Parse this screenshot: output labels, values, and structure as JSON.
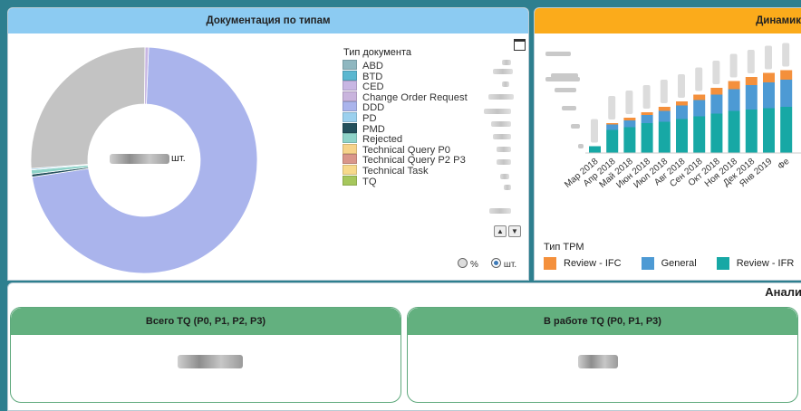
{
  "panels": {
    "documents_by_type": {
      "title": "Документация по типам",
      "center_unit": "шт.",
      "legend_title": "Тип документа",
      "legend": [
        {
          "label": "ABD",
          "color": "#8fb7c0"
        },
        {
          "label": "BTD",
          "color": "#5ab7d0"
        },
        {
          "label": "CED",
          "color": "#c8b6e3"
        },
        {
          "label": "Change Order Request",
          "color": "#c9b4dd"
        },
        {
          "label": "DDD",
          "color": "#aab4ec"
        },
        {
          "label": "PD",
          "color": "#9bd0ee"
        },
        {
          "label": "PMD",
          "color": "#23505c"
        },
        {
          "label": "Rejected",
          "color": "#8ed3c8"
        },
        {
          "label": "Technical Query P0",
          "color": "#f6d38a"
        },
        {
          "label": "Technical Query P2 P3",
          "color": "#d9968a"
        },
        {
          "label": "Technical Task",
          "color": "#f7d98b"
        },
        {
          "label": "TQ",
          "color": "#a6c75c"
        }
      ],
      "toggle": {
        "percent_label": "%",
        "count_label": "шт.",
        "selected": "шт."
      },
      "icons": {
        "maximize": "maximize-icon",
        "scroll_up": "chevron-up-icon",
        "scroll_down": "chevron-down-icon"
      }
    },
    "dynamics": {
      "title_visible": "Динамик",
      "month_labels": [
        "Мар 2018",
        "Апр 2018",
        "Май 2018",
        "Июн 2018",
        "Июл 2018",
        "Авг 2018",
        "Сен 2018",
        "Окт 2018",
        "Ноя 2018",
        "Дек 2018",
        "Янв 2019",
        "Фе"
      ],
      "tpm_legend_title": "Тип ТРМ",
      "tpm_legend": [
        {
          "label": "Review - IFC",
          "color": "#f4903c"
        },
        {
          "label": "General",
          "color": "#4d9ad4"
        },
        {
          "label": "Review - IFR",
          "color": "#17a8a5"
        }
      ]
    },
    "analytics": {
      "title_visible": "Анали",
      "kpis": [
        {
          "label": "Всего TQ (P0, P1, P2, P3)"
        },
        {
          "label": "В работе TQ (P0, P1, P3)"
        }
      ]
    }
  },
  "chart_data": [
    {
      "type": "pie",
      "title": "Документация по типам",
      "legend_position": "right",
      "donut": true,
      "slices": [
        {
          "label": "DDD",
          "share": 0.72,
          "color": "#aab4ec"
        },
        {
          "label": "PMD",
          "share": 0.004,
          "color": "#23505c"
        },
        {
          "label": "Rejected",
          "share": 0.006,
          "color": "#8ed3c8"
        },
        {
          "label": "PD",
          "share": 0.002,
          "color": "#9bd0ee"
        },
        {
          "label": "Other (grey)",
          "share": 0.263,
          "color": "#c3c3c3"
        },
        {
          "label": "CED",
          "share": 0.005,
          "color": "#c8b6e3"
        }
      ]
    },
    {
      "type": "bar",
      "title": "Динамик",
      "stacked": true,
      "categories": [
        "Мар 2018",
        "Апр 2018",
        "Май 2018",
        "Июн 2018",
        "Июл 2018",
        "Авг 2018",
        "Сен 2018",
        "Окт 2018",
        "Ноя 2018",
        "Дек 2018",
        "Янв 2019",
        "Фе"
      ],
      "series": [
        {
          "name": "Review - IFR",
          "color": "#17a8a5",
          "values": [
            0.05,
            0.17,
            0.19,
            0.22,
            0.23,
            0.25,
            0.27,
            0.29,
            0.31,
            0.32,
            0.33,
            0.34
          ]
        },
        {
          "name": "General",
          "color": "#4d9ad4",
          "values": [
            0,
            0.04,
            0.05,
            0.06,
            0.08,
            0.1,
            0.12,
            0.14,
            0.16,
            0.18,
            0.19,
            0.2
          ]
        },
        {
          "name": "Review - IFC",
          "color": "#f4903c",
          "values": [
            0,
            0.01,
            0.02,
            0.02,
            0.03,
            0.03,
            0.04,
            0.05,
            0.06,
            0.06,
            0.07,
            0.07
          ]
        }
      ]
    }
  ]
}
